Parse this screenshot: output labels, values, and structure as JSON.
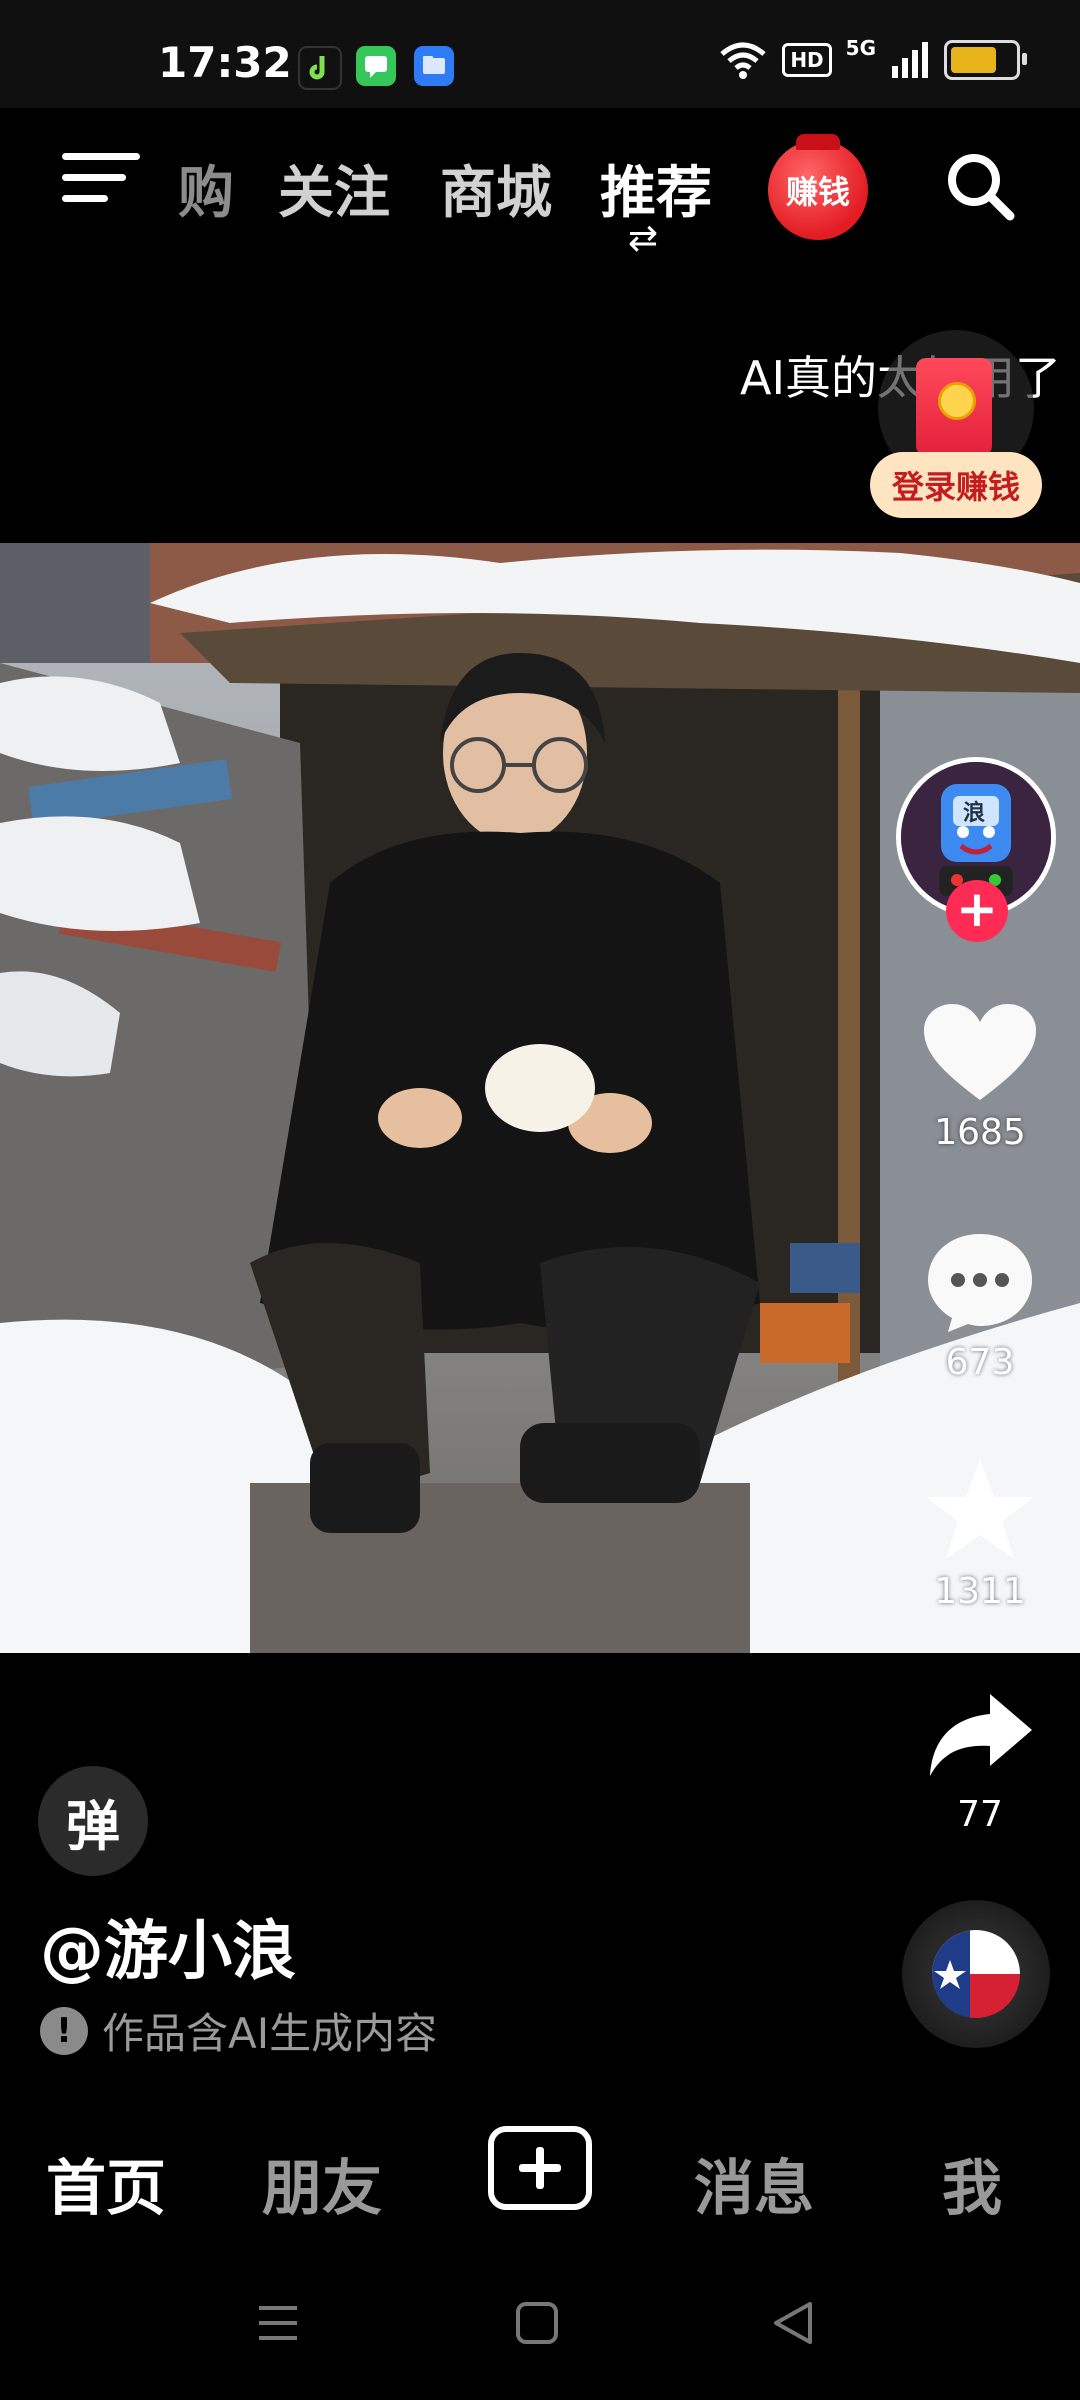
{
  "status_bar": {
    "time": "17:32",
    "network": "5G",
    "hd_label": "HD",
    "battery_level": 0.8,
    "battery_color": "#e8b21a",
    "app_icons": [
      "douyin-notification-icon",
      "messages-app-icon",
      "files-app-icon"
    ]
  },
  "top_nav": {
    "tabs": [
      "购",
      "关注",
      "商城",
      "推荐"
    ],
    "active_tab": "推荐",
    "earn_badge": "赚钱"
  },
  "caption_scroll": "AI真的太好用了",
  "login_earn": "登录赚钱",
  "actions": {
    "likes": "1685",
    "comments": "673",
    "favorites": "1311",
    "shares": "77"
  },
  "danmaku_label": "弹",
  "author": "@游小浪",
  "ai_notice": "作品含AI生成内容",
  "avatar_char": "浪",
  "bottom_tabs": {
    "home": "首页",
    "friends": "朋友",
    "messages": "消息",
    "me": "我"
  },
  "colors": {
    "accent": "#fe2c55",
    "earn_red": "#e31b23",
    "login_bg": "#ffe4c2"
  }
}
